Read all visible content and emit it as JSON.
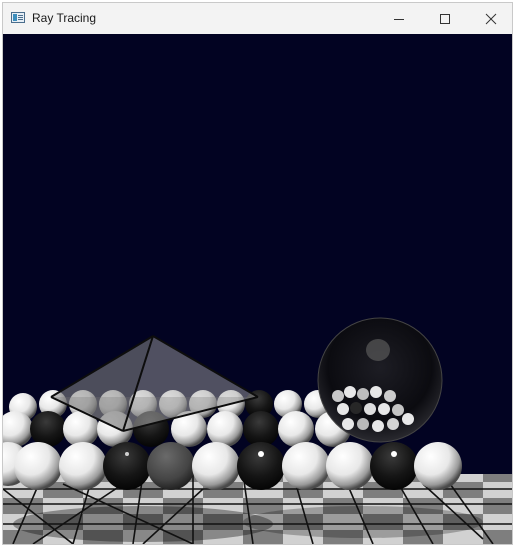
{
  "window": {
    "title": "Ray Tracing",
    "icon": "app-window-icon",
    "controls": {
      "minimize_icon": "minimize-icon",
      "maximize_icon": "maximize-icon",
      "close_icon": "close-icon"
    }
  },
  "scene": {
    "background_color": "#020322",
    "floor_colors": [
      "#ffffff",
      "#9a9a9a"
    ]
  }
}
